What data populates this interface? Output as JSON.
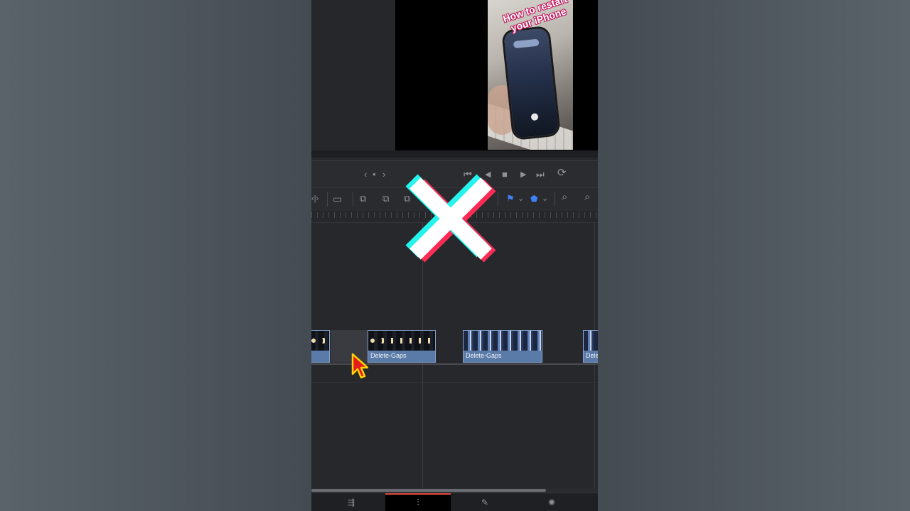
{
  "preview": {
    "caption": "How to restart your iPhone"
  },
  "transport": {
    "nav_prev": "‹",
    "nav_dot": "●",
    "nav_next": "›",
    "skip_back": "⏮",
    "step_back": "◀",
    "stop": "■",
    "play": "▶",
    "skip_forward": "⏭",
    "loop": "⟳"
  },
  "toolbar": {
    "trim_glyph": "‹|›",
    "blade_glyph": "▭",
    "insert_glyph": "⧉",
    "overwrite_glyph": "⧉",
    "replace_glyph": "⧉",
    "flag_glyph": "⚑",
    "marker_glyph": "⬟",
    "chevron": "⌄",
    "zoom_glyph": "⌕"
  },
  "timeline": {
    "clips": [
      {
        "label": "",
        "style": "faces"
      },
      {
        "label": "Delete-Gaps",
        "style": "faces"
      },
      {
        "label": "Delete-Gaps",
        "style": "blueppl"
      },
      {
        "label": "Dele",
        "style": "blueppl"
      }
    ]
  },
  "pages": {
    "tabs": [
      {
        "name": "cut",
        "glyph": "⇶"
      },
      {
        "name": "edit",
        "glyph": "⫶",
        "active": true
      },
      {
        "name": "color",
        "glyph": "✎"
      },
      {
        "name": "deliver",
        "glyph": "✺"
      }
    ]
  },
  "colors": {
    "clip_fill": "#5a7aa8",
    "accent_red": "#e0483c",
    "tiktok_cyan": "#25f4ee",
    "tiktok_pink": "#fe2c55",
    "cursor_yellow": "#ffd400",
    "cursor_red": "#e21b1b"
  }
}
